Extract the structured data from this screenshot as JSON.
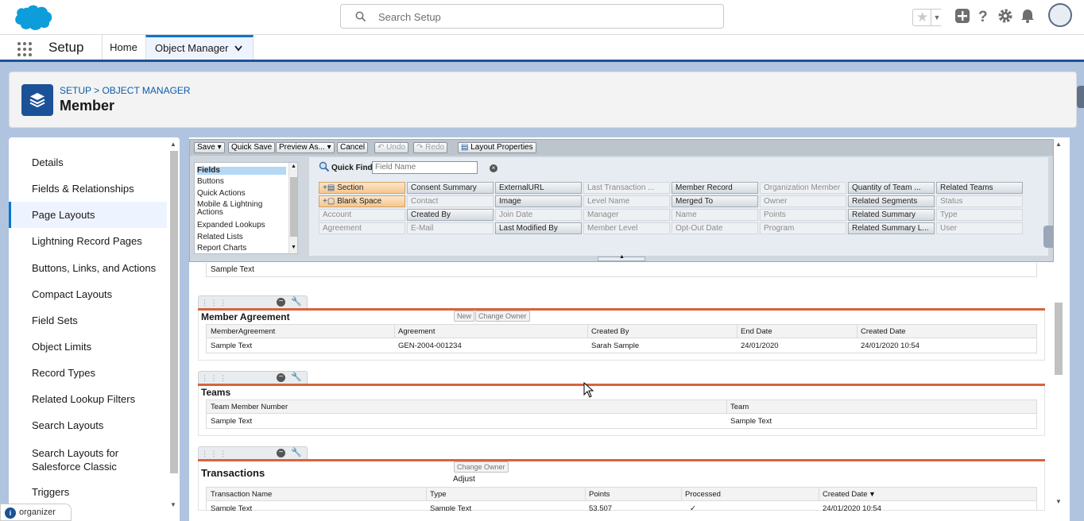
{
  "header": {
    "search_placeholder": "Search Setup",
    "icons": [
      "favorites-star-icon",
      "add-icon",
      "help-icon",
      "gear-icon",
      "bell-icon",
      "avatar"
    ]
  },
  "nav": {
    "app_name": "Setup",
    "tabs": [
      {
        "label": "Home"
      },
      {
        "label": "Object Manager",
        "active": true
      }
    ]
  },
  "page": {
    "breadcrumb": "SETUP > OBJECT MANAGER",
    "title": "Member"
  },
  "sidebar": {
    "items": [
      {
        "label": "Details"
      },
      {
        "label": "Fields & Relationships"
      },
      {
        "label": "Page Layouts",
        "active": true
      },
      {
        "label": "Lightning Record Pages"
      },
      {
        "label": "Buttons, Links, and Actions"
      },
      {
        "label": "Compact Layouts"
      },
      {
        "label": "Field Sets"
      },
      {
        "label": "Object Limits"
      },
      {
        "label": "Record Types"
      },
      {
        "label": "Related Lookup Filters"
      },
      {
        "label": "Search Layouts"
      },
      {
        "label": "Search Layouts for Salesforce Classic"
      },
      {
        "label": "Triggers"
      }
    ]
  },
  "toolbar": {
    "save": "Save",
    "quick_save": "Quick Save",
    "preview_as": "Preview As...",
    "cancel": "Cancel",
    "undo": "Undo",
    "redo": "Redo",
    "layout_properties": "Layout Properties"
  },
  "palette": {
    "categories": [
      "Fields",
      "Buttons",
      "Quick Actions",
      "Mobile & Lightning Actions",
      "Expanded Lookups",
      "Related Lists",
      "Report Charts"
    ],
    "quick_find_label": "Quick Find",
    "quick_find_placeholder": "Field Name",
    "fields": [
      [
        "Section",
        "Consent Summary",
        "ExternalURL",
        "Last Transaction ...",
        "Member Record",
        "Organization Member",
        "Quantity of Team ...",
        "Related Teams"
      ],
      [
        "Blank Space",
        "Contact",
        "Image",
        "Level Name",
        "Merged To",
        "Owner",
        "Related Segments",
        "Status"
      ],
      [
        "Account",
        "Created By",
        "Join Date",
        "Manager",
        "Name",
        "Points",
        "Related Summary",
        "Type"
      ],
      [
        "Agreement",
        "E-Mail",
        "Last Modified By",
        "Member Level",
        "Opt-Out Date",
        "Program",
        "Related Summary L...",
        "User"
      ]
    ]
  },
  "layout": {
    "top_sample": "Sample Text",
    "member_agreement": {
      "title": "Member Agreement",
      "buttons": [
        "New",
        "Change Owner"
      ],
      "columns": [
        "MemberAgreement",
        "Agreement",
        "Created By",
        "End Date",
        "Created Date"
      ],
      "row": [
        "Sample Text",
        "GEN-2004-001234",
        "Sarah Sample",
        "24/01/2020",
        "24/01/2020 10:54"
      ]
    },
    "teams": {
      "title": "Teams",
      "columns": [
        "Team Member Number",
        "Team"
      ],
      "row": [
        "Sample Text",
        "Sample Text"
      ]
    },
    "transactions": {
      "title": "Transactions",
      "buttons": [
        "Change Owner"
      ],
      "adjust": "Adjust",
      "columns": [
        "Transaction Name",
        "Type",
        "Points",
        "Processed",
        "Created Date"
      ],
      "row": [
        "Sample Text",
        "Sample Text",
        "53,507",
        "✓",
        "24/01/2020 10:54"
      ]
    }
  },
  "organizer": {
    "label": "organizer"
  },
  "colors": {
    "brand": "#0176d3",
    "section_line": "#d9633c",
    "nav_border": "#1b5297"
  }
}
